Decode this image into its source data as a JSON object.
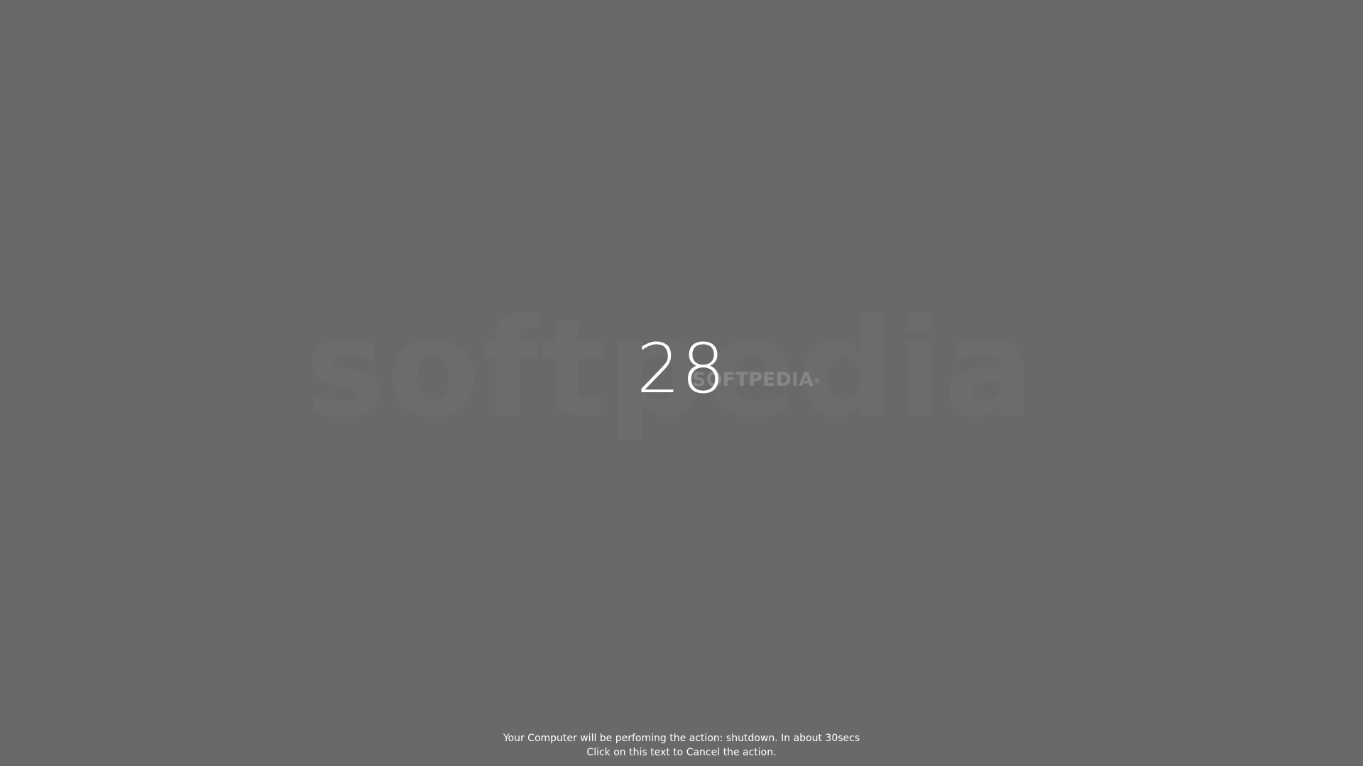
{
  "colors": {
    "background": "#696969",
    "text": "#ffffff"
  },
  "countdown": {
    "value": "28"
  },
  "watermark": {
    "logo": "SOFTPEDIA",
    "mark": "®"
  },
  "message": {
    "line1": "Your Computer will be perfoming the action: shutdown. In about 30secs",
    "line2": "Click on this text to Cancel the action."
  }
}
